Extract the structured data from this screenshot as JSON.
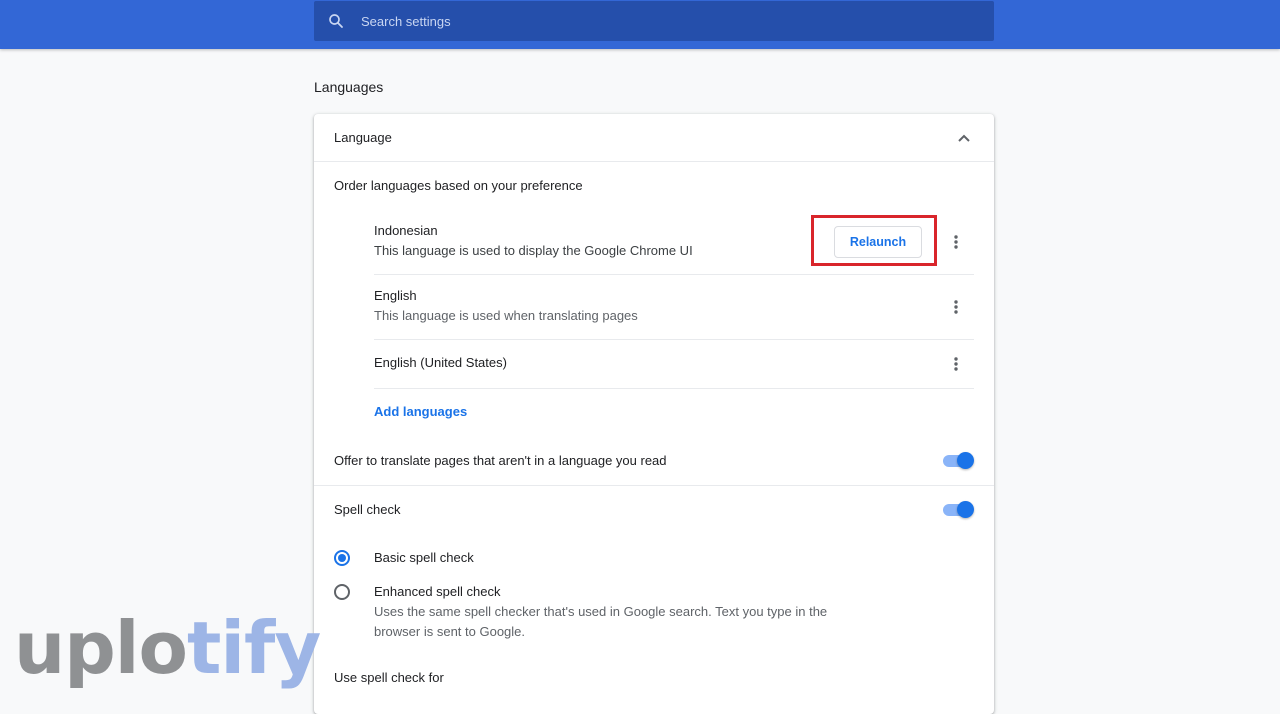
{
  "search": {
    "placeholder": "Search settings",
    "icon": "search-icon"
  },
  "section": {
    "title": "Languages"
  },
  "language_card": {
    "header": "Language",
    "order_label": "Order languages based on your preference",
    "languages": [
      {
        "name": "Indonesian",
        "description": "This language is used to display the Google Chrome UI",
        "action_label": "Relaunch"
      },
      {
        "name": "English",
        "description": "This language is used when translating pages"
      },
      {
        "name": "English (United States)"
      }
    ],
    "add_languages_label": "Add languages",
    "offer_translate": {
      "label": "Offer to translate pages that aren't in a language you read",
      "enabled": true
    }
  },
  "spell_check": {
    "label": "Spell check",
    "enabled": true,
    "options": [
      {
        "label": "Basic spell check",
        "selected": true
      },
      {
        "label": "Enhanced spell check",
        "description_line1": "Uses the same spell checker that's used in Google search. Text you type in the",
        "description_line2": "browser is sent to Google.",
        "selected": false
      }
    ],
    "use_for_label": "Use spell check for"
  },
  "watermark": {
    "part1": "uplo",
    "part2": "tify"
  },
  "colors": {
    "header_blue": "#3367d6",
    "accent_blue": "#1a73e8",
    "highlight_red": "#d9252b"
  }
}
